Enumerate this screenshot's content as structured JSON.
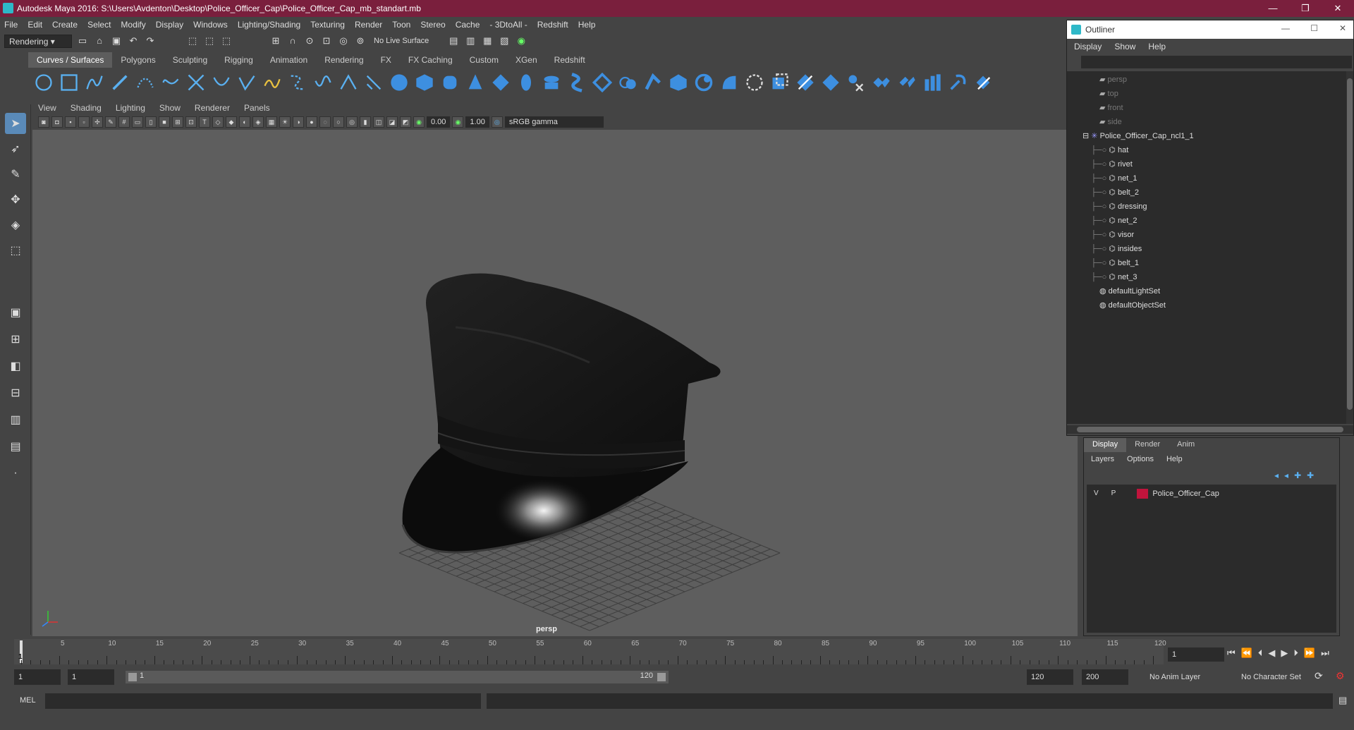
{
  "window": {
    "title": "Autodesk Maya 2016: S:\\Users\\Avdenton\\Desktop\\Police_Officer_Cap\\Police_Officer_Cap_mb_standart.mb",
    "minimize": "—",
    "maximize": "❐",
    "close": "✕"
  },
  "menu": [
    "File",
    "Edit",
    "Create",
    "Select",
    "Modify",
    "Display",
    "Windows",
    "Lighting/Shading",
    "Texturing",
    "Render",
    "Toon",
    "Stereo",
    "Cache",
    "- 3DtoAll -",
    "Redshift",
    "Help"
  ],
  "status": {
    "mode": "Rendering",
    "live_surface": "No Live Surface"
  },
  "shelf_tabs": [
    "Curves / Surfaces",
    "Polygons",
    "Sculpting",
    "Rigging",
    "Animation",
    "Rendering",
    "FX",
    "FX Caching",
    "Custom",
    "XGen",
    "Redshift"
  ],
  "shelf_active": "Curves / Surfaces",
  "viewport": {
    "menu": [
      "View",
      "Shading",
      "Lighting",
      "Show",
      "Renderer",
      "Panels"
    ],
    "exposure": "0.00",
    "gamma": "1.00",
    "color_space": "sRGB gamma",
    "camera_label": "persp"
  },
  "outliner": {
    "title": "Outliner",
    "menu": [
      "Display",
      "Show",
      "Help"
    ],
    "cameras": [
      "persp",
      "top",
      "front",
      "side"
    ],
    "group": "Police_Officer_Cap_ncl1_1",
    "children": [
      "hat",
      "rivet",
      "net_1",
      "belt_2",
      "dressing",
      "net_2",
      "visor",
      "insides",
      "belt_1",
      "net_3"
    ],
    "sets": [
      "defaultLightSet",
      "defaultObjectSet"
    ]
  },
  "layer_editor": {
    "tabs": [
      "Display",
      "Render",
      "Anim"
    ],
    "menu": [
      "Layers",
      "Options",
      "Help"
    ],
    "layer": {
      "v": "V",
      "p": "P",
      "name": "Police_Officer_Cap",
      "color": "#c0143c"
    }
  },
  "timeline": {
    "ticks": [
      "5",
      "10",
      "15",
      "20",
      "25",
      "30",
      "35",
      "40",
      "45",
      "50",
      "55",
      "60",
      "65",
      "70",
      "75",
      "80",
      "85",
      "90",
      "95",
      "100",
      "105",
      "110",
      "115",
      "120"
    ],
    "current_frame": "1",
    "current_marker": "1"
  },
  "range": {
    "start": "1",
    "start2": "1",
    "slider_start": "1",
    "slider_end": "120",
    "end": "120",
    "end2": "200",
    "anim_layer": "No Anim Layer",
    "char_set": "No Character Set"
  },
  "mel": {
    "label": "MEL"
  }
}
